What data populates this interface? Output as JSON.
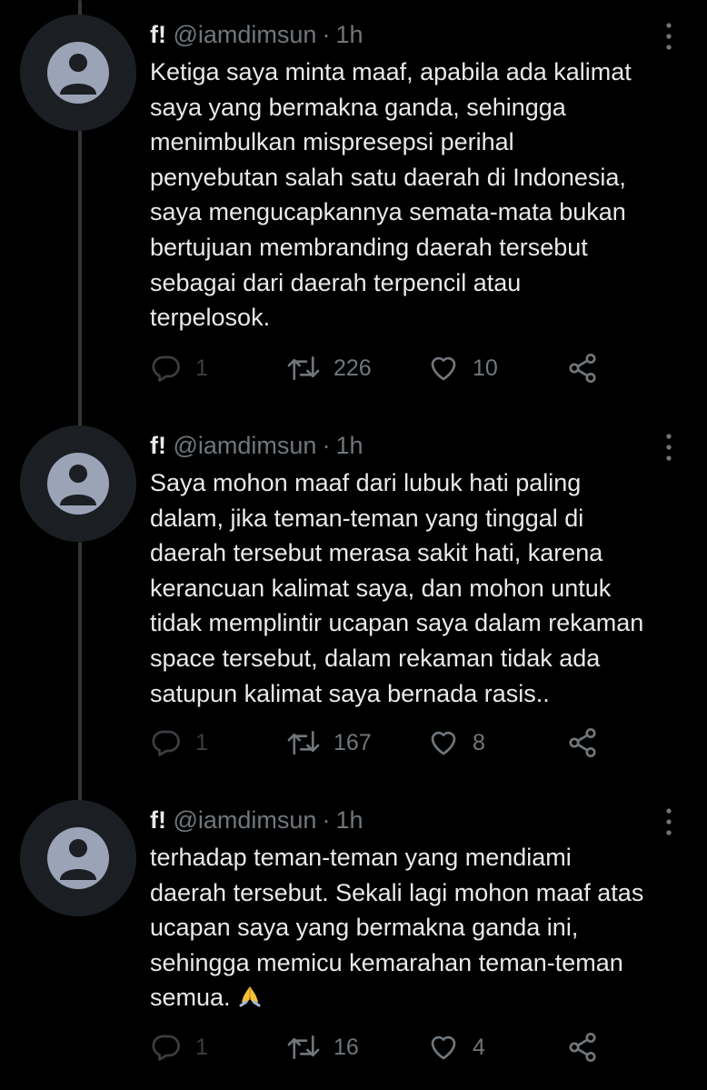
{
  "colors": {
    "background": "#000000",
    "text": "#e7e9ea",
    "secondary": "#71767b",
    "thread_line": "#333639",
    "avatar_bg": "#1b1f24",
    "avatar_figure": "#9aa4b6"
  },
  "tweets": [
    {
      "display_name": "f!",
      "handle": "@iamdimsun",
      "separator": "·",
      "time": "1h",
      "lines": [
        "Ketiga saya minta maaf, apabila ada kalimat",
        "saya yang bermakna ganda, sehingga",
        "menimbulkan mispresepsi perihal",
        "penyebutan salah satu daerah di Indonesia,",
        "saya mengucapkannya semata-mata bukan",
        "bertujuan membranding daerah tersebut",
        "sebagai dari daerah terpencil atau",
        "terpelosok."
      ],
      "replies": "1",
      "retweets": "226",
      "likes": "10"
    },
    {
      "display_name": "f!",
      "handle": "@iamdimsun",
      "separator": "·",
      "time": "1h",
      "lines": [
        "Saya mohon maaf dari lubuk hati paling",
        "dalam, jika teman-teman yang tinggal di",
        "daerah tersebut merasa sakit hati, karena",
        "kerancuan kalimat saya, dan mohon untuk",
        "tidak memplintir ucapan saya dalam rekaman",
        "space tersebut, dalam rekaman tidak ada",
        "satupun kalimat saya bernada rasis.."
      ],
      "replies": "1",
      "retweets": "167",
      "likes": "8"
    },
    {
      "display_name": "f!",
      "handle": "@iamdimsun",
      "separator": "·",
      "time": "1h",
      "lines": [
        "terhadap teman-teman yang mendiami",
        "daerah tersebut. Sekali lagi mohon maaf atas",
        "ucapan saya yang bermakna ganda ini,",
        "sehingga memicu kemarahan teman-teman",
        "semua."
      ],
      "emoji": "folded-hands-icon",
      "replies": "1",
      "retweets": "16",
      "likes": "4"
    }
  ]
}
